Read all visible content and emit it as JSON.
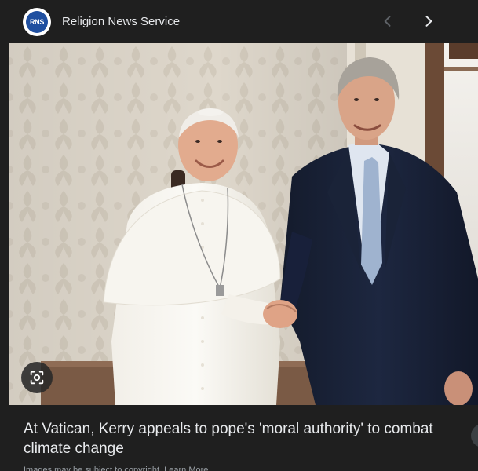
{
  "source": {
    "name": "Religion News Service",
    "logo_text": "RNS"
  },
  "nav": {
    "prev_icon": "chevron-left-icon",
    "next_icon": "chevron-right-icon"
  },
  "image": {
    "lens_icon": "visual-search-icon"
  },
  "article": {
    "headline": "At Vatican, Kerry appeals to pope's 'moral authority' to combat climate change",
    "subline": "Images may be subject to copyright. Learn More"
  }
}
